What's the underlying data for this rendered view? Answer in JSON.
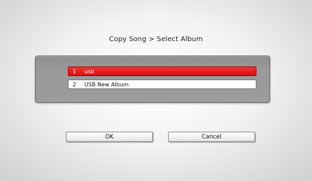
{
  "dialog": {
    "title": "Copy Song > Select Album"
  },
  "albums": [
    {
      "number": "1",
      "name": "usb",
      "selected": true
    },
    {
      "number": "2",
      "name": "USB New Album",
      "selected": false
    }
  ],
  "buttons": {
    "ok_label": "OK",
    "cancel_label": "Cancel"
  },
  "colors": {
    "selection": "#e01c1c",
    "panel": "#9a9a9a",
    "background": "#f2f2f2"
  }
}
